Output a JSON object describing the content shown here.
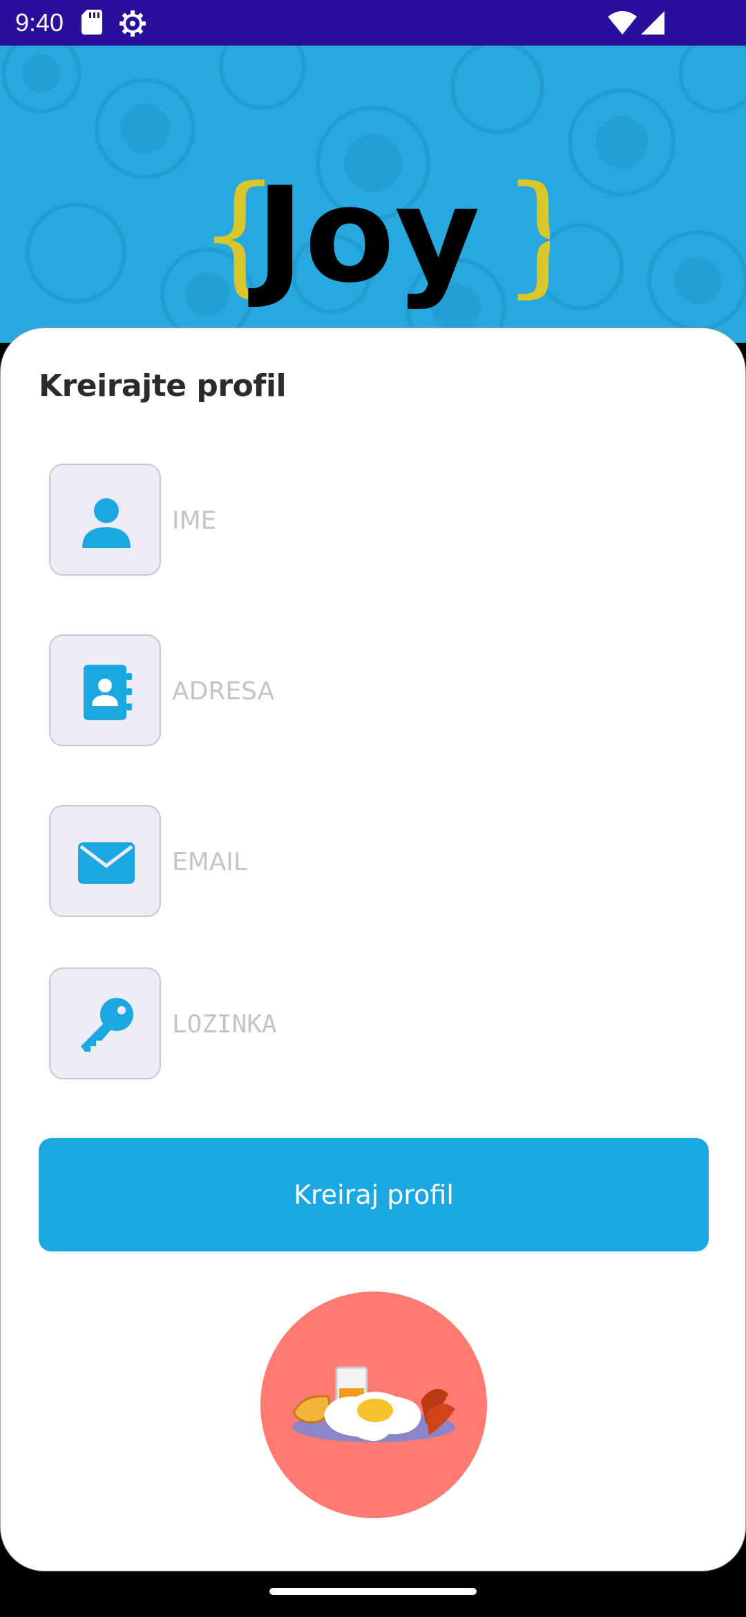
{
  "status_bar": {
    "time": "9:40",
    "icons": [
      "sd-card-icon",
      "settings-gear-icon",
      "wifi-icon",
      "signal-icon"
    ]
  },
  "header": {
    "logo_text": "Joy",
    "logo_brace_left": "{",
    "logo_brace_right": "}",
    "colors": {
      "background": "#27a8df",
      "logo": "#000000",
      "braces": "#d9c62a"
    }
  },
  "form": {
    "title": "Kreirajte profil",
    "fields": [
      {
        "icon": "person-icon",
        "placeholder": "IME",
        "value": ""
      },
      {
        "icon": "address-book-icon",
        "placeholder": "ADRESA",
        "value": ""
      },
      {
        "icon": "envelope-icon",
        "placeholder": "EMAIL",
        "value": ""
      },
      {
        "icon": "key-icon",
        "placeholder": "LOZINKA",
        "value": ""
      }
    ],
    "submit_label": "Kreiraj profil",
    "colors": {
      "accent": "#1ba8e2",
      "icon_box": "#ecebf6",
      "illustration_bg": "#ff7b72"
    }
  },
  "illustration": {
    "icon": "breakfast-plate-icon"
  }
}
